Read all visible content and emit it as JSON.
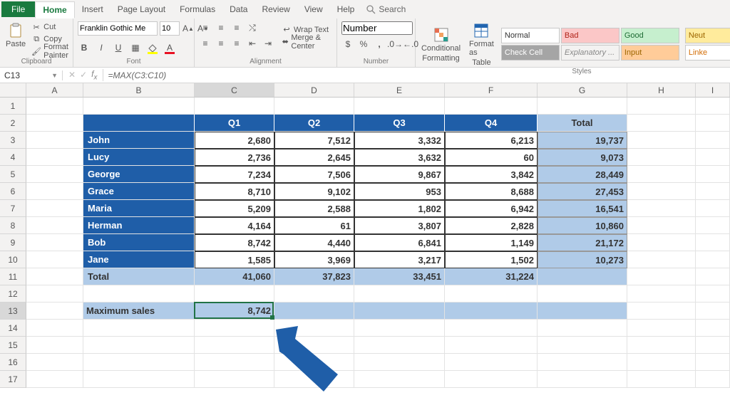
{
  "tabs": {
    "file": "File",
    "home": "Home",
    "insert": "Insert",
    "page_layout": "Page Layout",
    "formulas": "Formulas",
    "data": "Data",
    "review": "Review",
    "view": "View",
    "help": "Help",
    "search": "Search"
  },
  "clipboard": {
    "paste": "Paste",
    "cut": "Cut",
    "copy": "Copy",
    "format_painter": "Format Painter",
    "group": "Clipboard"
  },
  "font": {
    "family": "Franklin Gothic Me",
    "size": "10",
    "group": "Font"
  },
  "alignment": {
    "wrap": "Wrap Text",
    "merge": "Merge & Center",
    "group": "Alignment"
  },
  "number": {
    "format": "Number",
    "group": "Number"
  },
  "styles": {
    "cond": "Conditional Formatting",
    "cond1": "Conditional",
    "cond2": "Formatting",
    "table": "Format as Table",
    "table1": "Format as",
    "table2": "Table",
    "normal": "Normal",
    "bad": "Bad",
    "good": "Good",
    "neutral": "Neut",
    "check": "Check Cell",
    "explan": "Explanatory ...",
    "input": "Input",
    "linked": "Linke",
    "group": "Styles"
  },
  "name_box": "C13",
  "formula": "=MAX(C3:C10)",
  "columns": [
    "A",
    "B",
    "C",
    "D",
    "E",
    "F",
    "G",
    "H",
    "I"
  ],
  "rows": [
    "1",
    "2",
    "3",
    "4",
    "5",
    "6",
    "7",
    "8",
    "9",
    "10",
    "11",
    "12",
    "13",
    "14",
    "15",
    "16",
    "17"
  ],
  "table": {
    "headers": {
      "q1": "Q1",
      "q2": "Q2",
      "q3": "Q3",
      "q4": "Q4",
      "total": "Total"
    },
    "rows": [
      {
        "name": "John",
        "q1": "2,680",
        "q2": "7,512",
        "q3": "3,332",
        "q4": "6,213",
        "total": "19,737"
      },
      {
        "name": "Lucy",
        "q1": "2,736",
        "q2": "2,645",
        "q3": "3,632",
        "q4": "60",
        "total": "9,073"
      },
      {
        "name": "George",
        "q1": "7,234",
        "q2": "7,506",
        "q3": "9,867",
        "q4": "3,842",
        "total": "28,449"
      },
      {
        "name": "Grace",
        "q1": "8,710",
        "q2": "9,102",
        "q3": "953",
        "q4": "8,688",
        "total": "27,453"
      },
      {
        "name": "Maria",
        "q1": "5,209",
        "q2": "2,588",
        "q3": "1,802",
        "q4": "6,942",
        "total": "16,541"
      },
      {
        "name": "Herman",
        "q1": "4,164",
        "q2": "61",
        "q3": "3,807",
        "q4": "2,828",
        "total": "10,860"
      },
      {
        "name": "Bob",
        "q1": "8,742",
        "q2": "4,440",
        "q3": "6,841",
        "q4": "1,149",
        "total": "21,172"
      },
      {
        "name": "Jane",
        "q1": "1,585",
        "q2": "3,969",
        "q3": "3,217",
        "q4": "1,502",
        "total": "10,273"
      }
    ],
    "totals": {
      "label": "Total",
      "q1": "41,060",
      "q2": "37,823",
      "q3": "33,451",
      "q4": "31,224"
    },
    "max": {
      "label": "Maximum sales",
      "value": "8,742"
    }
  }
}
